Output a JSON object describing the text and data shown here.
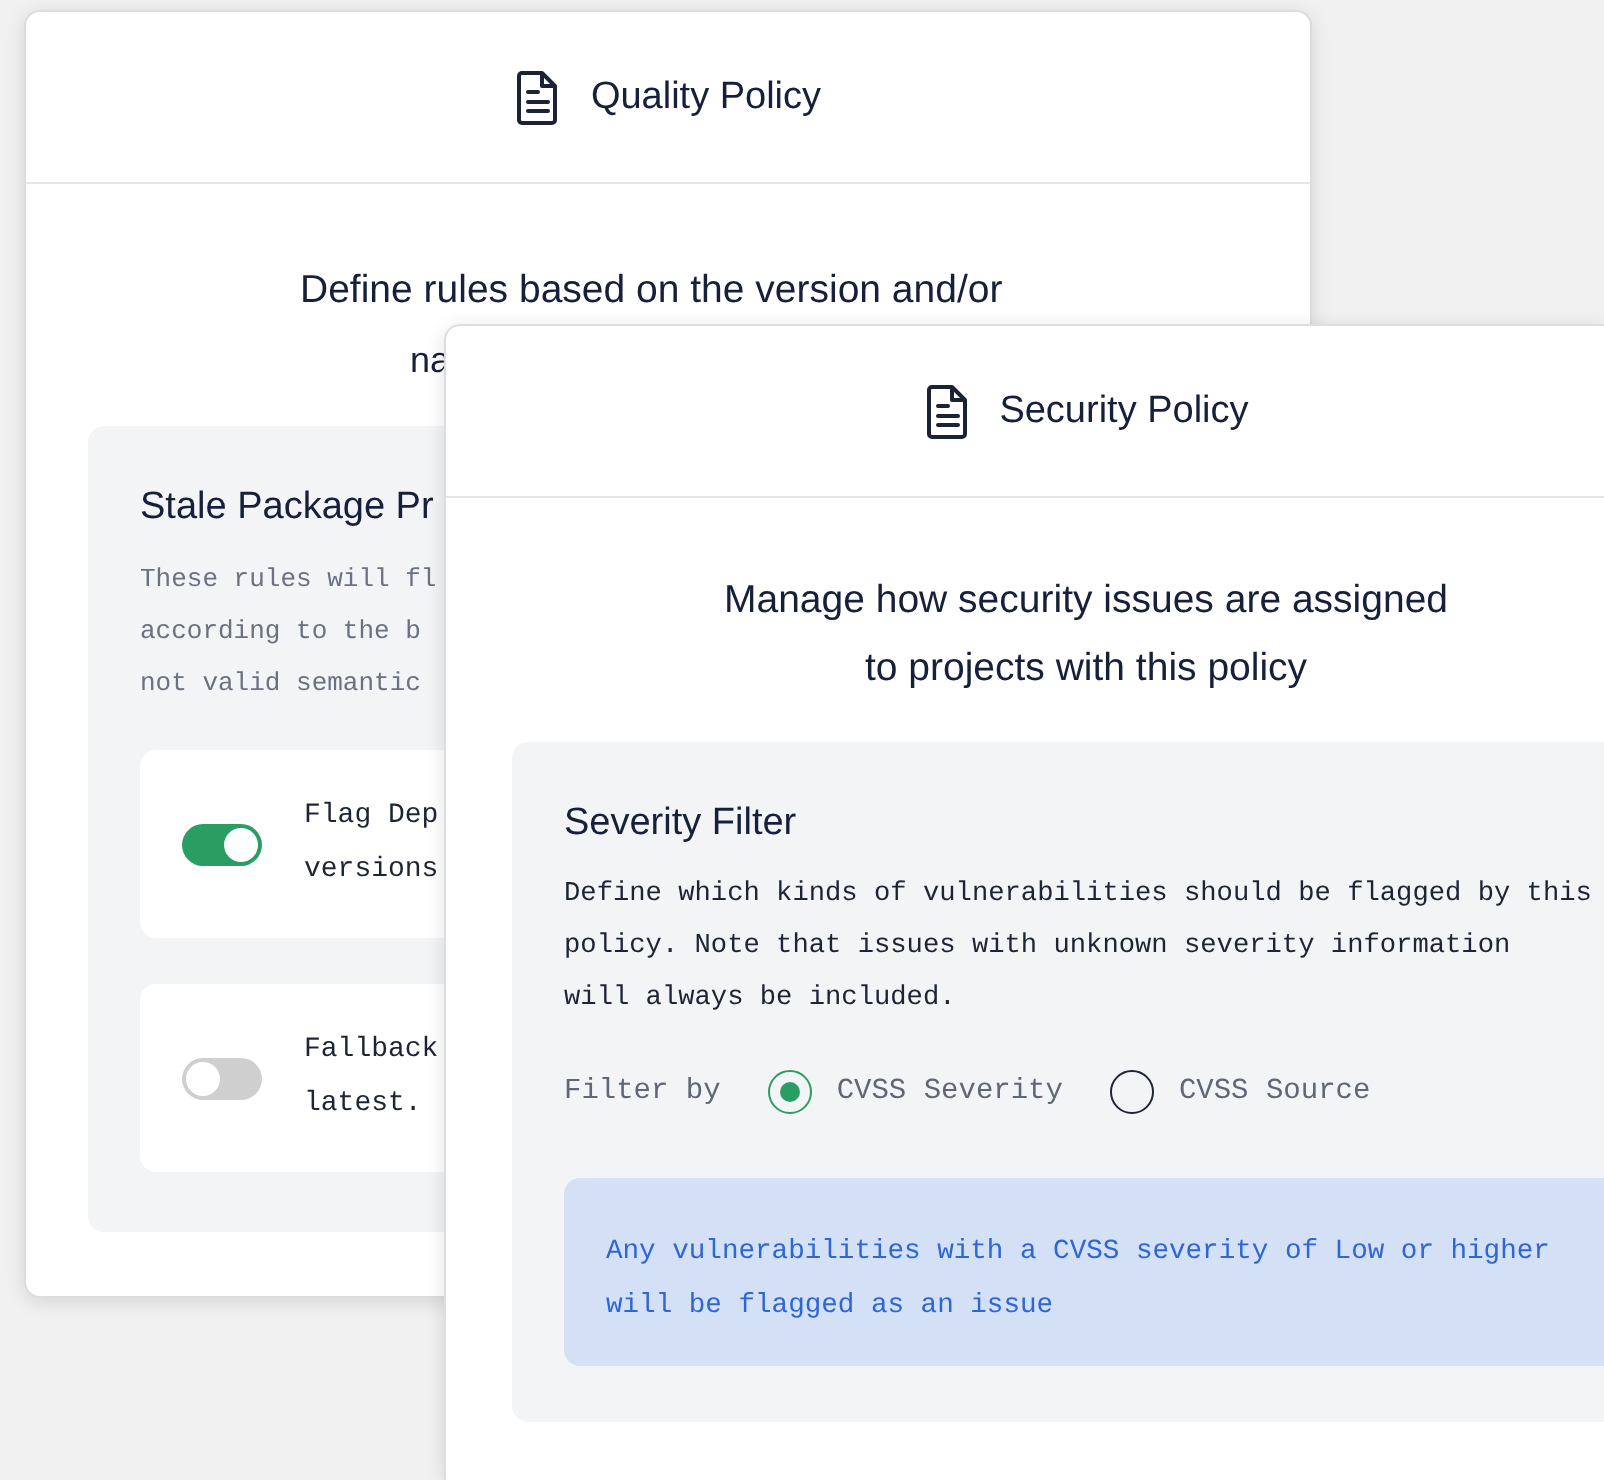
{
  "quality_policy": {
    "title": "Quality Policy",
    "subtitle_lines": [
      "Define rules based on the version and/or",
      "na"
    ],
    "section": {
      "title": "Stale Package Pr",
      "description_lines": [
        "These rules will fl",
        "according to the b",
        "not valid semantic"
      ],
      "options": [
        {
          "label_lines": [
            "Flag Dep",
            "versions"
          ],
          "on": true
        },
        {
          "label_lines": [
            "Fallback",
            "latest."
          ],
          "on": false
        }
      ]
    }
  },
  "security_policy": {
    "title": "Security Policy",
    "subtitle": "Manage how security issues are assigned to projects with this policy",
    "section": {
      "title": "Severity Filter",
      "description_lines": [
        "Define which kinds of vulnerabilities should be flagged by this",
        "policy. Note that issues with unknown severity information",
        "will always be included."
      ],
      "filter": {
        "label": "Filter by",
        "options": [
          {
            "label": "CVSS Severity",
            "selected": true
          },
          {
            "label": "CVSS Source",
            "selected": false
          }
        ]
      },
      "notice": "Any vulnerabilities with a CVSS severity of Low or higher will be flagged as an issue"
    }
  }
}
